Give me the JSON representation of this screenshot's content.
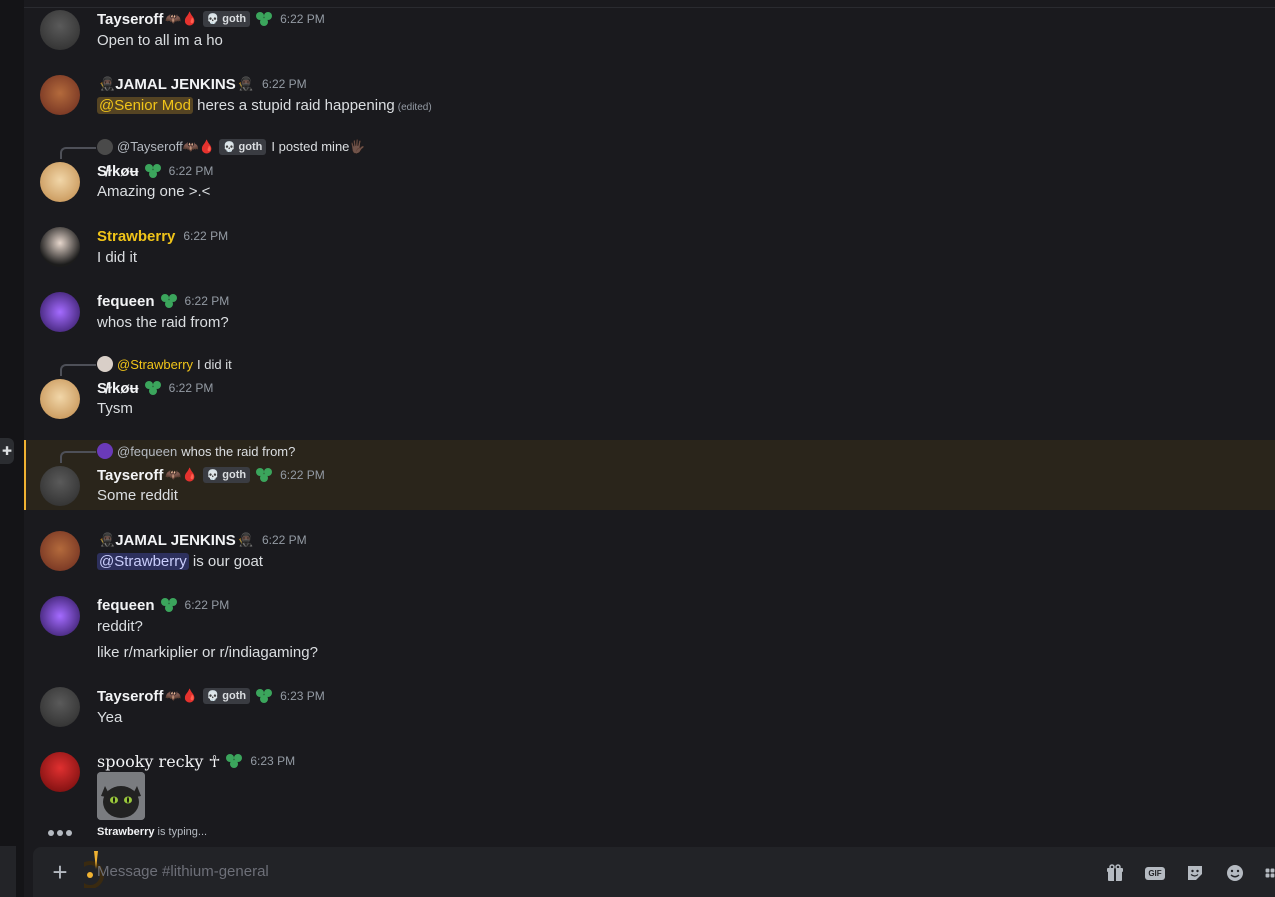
{
  "messages": [
    {
      "user": "Tayseroff",
      "emoji": "🦇🩸",
      "tag": "goth",
      "time": "6:22 PM",
      "lines": [
        "Open to all im a ho"
      ]
    },
    {
      "user": "JAMAL JENKINS",
      "time": "6:22 PM",
      "mention": "@Senior Mod",
      "text": " heres a stupid raid happening",
      "edited": "(edited)"
    },
    {
      "reply": {
        "name": "@Tayseroff🦇🩸",
        "tag": "goth",
        "text": "I posted mine🖐🏿"
      },
      "user": "S̸ɫkøʉ",
      "time": "6:22 PM",
      "lines": [
        "Amazing one >.<"
      ]
    },
    {
      "user": "Strawberry",
      "time": "6:22 PM",
      "lines": [
        "I did it"
      ]
    },
    {
      "user": "fequeen",
      "time": "6:22 PM",
      "lines": [
        "whos the raid from?"
      ]
    },
    {
      "reply": {
        "name": "@Strawberry",
        "text": "I did it"
      },
      "user": "S̸ɫkøʉ",
      "time": "6:22 PM",
      "lines": [
        "Tysm"
      ]
    },
    {
      "reply": {
        "name": "@fequeen",
        "text": "whos the raid from?"
      },
      "user": "Tayseroff",
      "emoji": "🦇🩸",
      "tag": "goth",
      "time": "6:22 PM",
      "lines": [
        "Some reddit"
      ]
    },
    {
      "user": "JAMAL JENKINS",
      "time": "6:22 PM",
      "mention": "@Strawberry",
      "text": " is our goat"
    },
    {
      "user": "fequeen",
      "time": "6:22 PM",
      "lines": [
        "reddit?",
        "like r/markiplier or r/indiagaming?"
      ]
    },
    {
      "user": "Tayseroff",
      "emoji": "🦇🩸",
      "tag": "goth",
      "time": "6:23 PM",
      "lines": [
        "Yea"
      ]
    },
    {
      "user": "spooky recky ☥",
      "time": "6:23 PM",
      "lines": []
    }
  ],
  "typing": {
    "name": "Strawberry",
    "suffix": " is typing..."
  },
  "composer": {
    "placeholder": "Message #lithium-general"
  },
  "colors": {
    "accent": "#f0b232",
    "mention_bg": "#5865f2",
    "online_green": "#3ba55c"
  }
}
